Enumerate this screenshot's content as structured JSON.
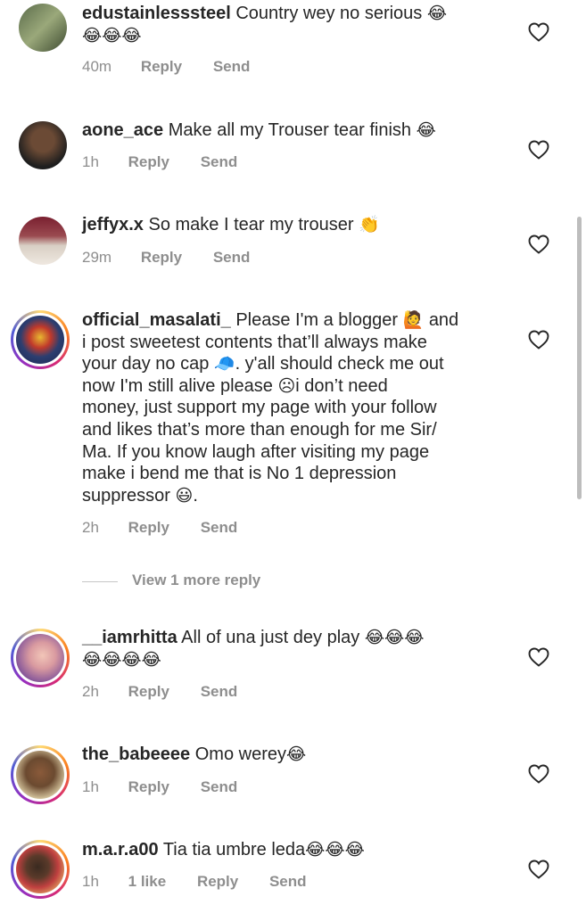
{
  "comments": [
    {
      "username": "edustainlesssteel",
      "text": "Country wey no serious",
      "emoji": "😂",
      "emoji_line2": "😂😂😂",
      "time": "40m",
      "reply": "Reply",
      "send": "Send"
    },
    {
      "username": "aone_ace",
      "text": "Make all my Trouser tear finish",
      "emoji": "😂",
      "time": "1h",
      "reply": "Reply",
      "send": "Send"
    },
    {
      "username": "jeffyx.x",
      "text": "So make I tear my trouser",
      "emoji": "👏",
      "time": "29m",
      "reply": "Reply",
      "send": "Send"
    },
    {
      "username": "official_masalati_",
      "text_line1": "Please I'm a blogger",
      "emoji_blogger": "🙋",
      "text_line1b": "and",
      "line2": "i post sweetest contents that’ll always make",
      "line3a": "your day no cap",
      "emoji_cap": "🧢",
      "line3b": ". y'all should check me out",
      "line4a": "now I'm still alive please",
      "emoji_sad": "☹",
      "line4b": "i don’t need",
      "line5": "money, just support my page with your follow",
      "line6": "and likes that’s more than enough for me Sir/",
      "line7": "Ma. If you know laugh after visiting my page",
      "line8": "make i bend me that is No 1 depression",
      "line9a": "suppressor",
      "emoji_smile": "😃",
      "line9b": ".",
      "time": "2h",
      "reply": "Reply",
      "send": "Send",
      "view_more": "View 1 more reply"
    },
    {
      "username": "__iamrhitta",
      "text": "All of una just dey play",
      "emoji": "😂😂😂",
      "emoji_line2": "😂😂😂😂",
      "time": "2h",
      "reply": "Reply",
      "send": "Send"
    },
    {
      "username": "the_babeeee",
      "text": "Omo werey",
      "emoji": "😂",
      "time": "1h",
      "reply": "Reply",
      "send": "Send"
    },
    {
      "username": "m.a.r.a00",
      "text": "Tia tia umbre leda",
      "emoji": "😂😂😂",
      "time": "1h",
      "likes": "1 like",
      "reply": "Reply",
      "send": "Send"
    }
  ],
  "colors": {
    "text": "#262626",
    "meta": "#8e8e8e",
    "background": "#ffffff"
  },
  "icons": {
    "like": "heart-icon"
  }
}
